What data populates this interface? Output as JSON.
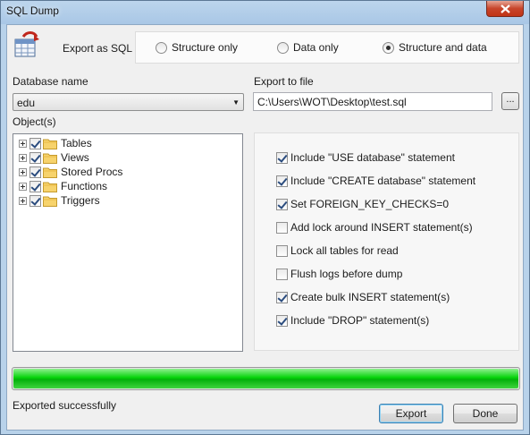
{
  "window": {
    "title": "SQL Dump"
  },
  "header": {
    "export_as_label": "Export as SQL",
    "radio_options": [
      {
        "label": "Structure only",
        "selected": false
      },
      {
        "label": "Data only",
        "selected": false
      },
      {
        "label": "Structure and data",
        "selected": true
      }
    ]
  },
  "database": {
    "label": "Database name",
    "selected": "edu"
  },
  "export_file": {
    "label": "Export to file",
    "value": "C:\\Users\\WOT\\Desktop\\test.sql",
    "browse_label": "..."
  },
  "objects": {
    "label": "Object(s)",
    "items": [
      {
        "label": "Tables",
        "checked": true
      },
      {
        "label": "Views",
        "checked": true
      },
      {
        "label": "Stored Procs",
        "checked": true
      },
      {
        "label": "Functions",
        "checked": true
      },
      {
        "label": "Triggers",
        "checked": true
      }
    ]
  },
  "options": [
    {
      "label": "Include \"USE database\" statement",
      "checked": true
    },
    {
      "label": "Include \"CREATE database\" statement",
      "checked": true
    },
    {
      "label": "Set FOREIGN_KEY_CHECKS=0",
      "checked": true
    },
    {
      "label": "Add lock around INSERT statement(s)",
      "checked": false
    },
    {
      "label": "Lock all tables for read",
      "checked": false
    },
    {
      "label": "Flush logs before dump",
      "checked": false
    },
    {
      "label": "Create bulk INSERT statement(s)",
      "checked": true
    },
    {
      "label": "Include \"DROP\" statement(s)",
      "checked": true
    }
  ],
  "progress": {
    "fraction": 1.0
  },
  "status": {
    "text": "Exported successfully"
  },
  "buttons": {
    "export_label": "Export",
    "done_label": "Done"
  },
  "colors": {
    "progress_fill": "#06d30b",
    "close_button": "#c7452b"
  }
}
